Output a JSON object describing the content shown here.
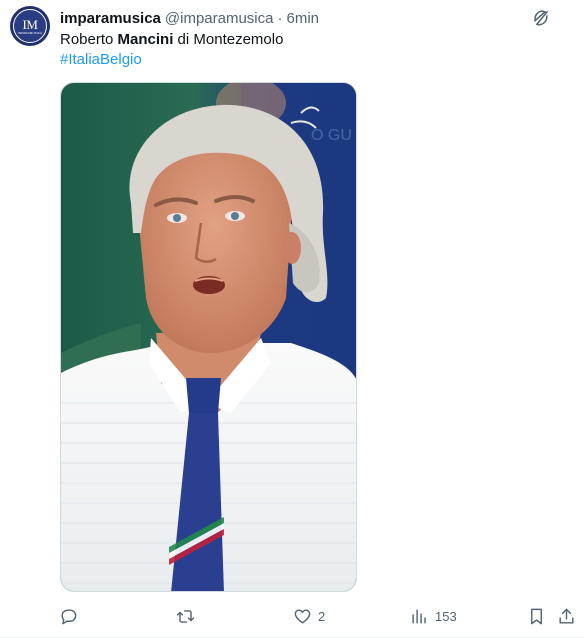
{
  "tweet": {
    "display_name": "imparamusica",
    "handle": "@imparamusica",
    "separator": "·",
    "time": "6min",
    "text_prefix": "Roberto ",
    "text_bold": "Mancini",
    "text_suffix": " di Montezemolo",
    "hashtag": "#ItaliaBelgio",
    "avatar_logo": "IM",
    "avatar_sub": "IMPARAMUSICA",
    "media_icon_names": [
      "grok-icon"
    ]
  },
  "actions": {
    "reply": {
      "icon": "reply-icon",
      "count": ""
    },
    "retweet": {
      "icon": "retweet-icon",
      "count": ""
    },
    "like": {
      "icon": "heart-icon",
      "count": "2"
    },
    "views": {
      "icon": "views-icon",
      "count": "153"
    },
    "bookmark": {
      "icon": "bookmark-icon"
    },
    "share": {
      "icon": "share-icon"
    }
  },
  "colors": {
    "text": "#0f1419",
    "muted": "#536471",
    "link": "#1d9bf0",
    "avatar_bg": "#1f2f6b"
  }
}
